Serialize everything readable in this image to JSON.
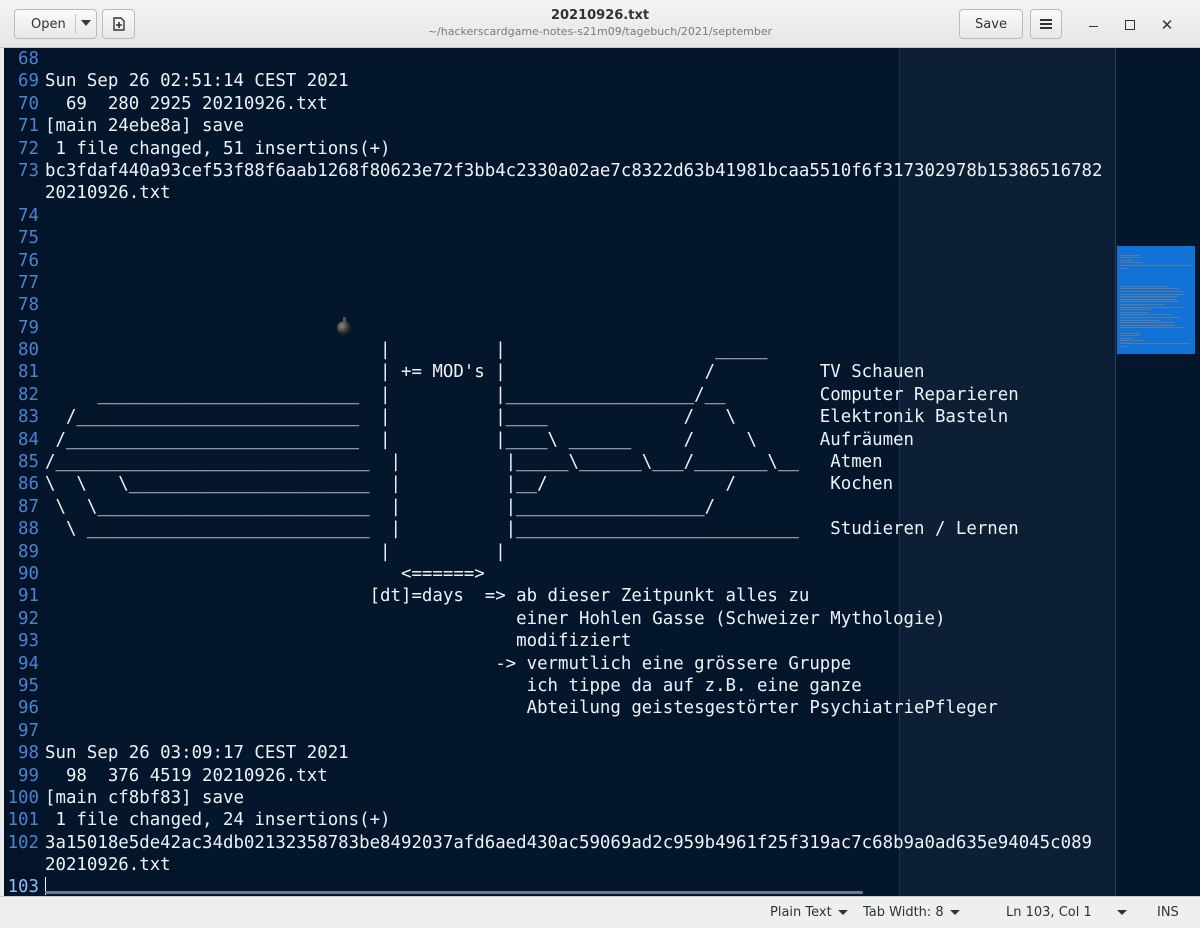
{
  "header": {
    "open_label": "Open",
    "save_label": "Save",
    "title": "20210926.txt",
    "subtitle": "~/hackerscardgame-notes-s21m09/tagebuch/2021/september"
  },
  "editor": {
    "line_numbers": [
      "68",
      "69",
      "70",
      "71",
      "72",
      "73",
      "",
      "74",
      "75",
      "76",
      "77",
      "78",
      "79",
      "80",
      "81",
      "82",
      "83",
      "84",
      "85",
      "86",
      "87",
      "88",
      "89",
      "90",
      "91",
      "92",
      "93",
      "94",
      "95",
      "96",
      "97",
      "98",
      "99",
      "100",
      "101",
      "102",
      "",
      "103"
    ],
    "lines": [
      "",
      "Sun Sep 26 02:51:14 CEST 2021",
      "  69  280 2925 20210926.txt",
      "[main 24ebe8a] save",
      " 1 file changed, 51 insertions(+)",
      "bc3fdaf440a93cef53f88f6aab1268f80623e72f3bb4c2330a02ae7c8322d63b41981bcaa5510f6f317302978b15386516782",
      "20210926.txt",
      "",
      "",
      "",
      "",
      "",
      "",
      "                                |          |                    _____",
      "                                | += MOD's |                   /          TV Schauen",
      "     _________________________  |          |__________________/__         Computer Reparieren",
      "  /___________________________  |          |____             /   \\        Elektronik Basteln",
      " /____________________________  |          |____\\ ______     /     \\      Aufräumen",
      "/______________________________  |          |_____\\______\\___/_______\\__   Atmen",
      "\\  \\   \\_______________________  |          |__/                 /         Kochen",
      " \\  \\__________________________  |          |__________________/",
      "  \\ ___________________________  |          |___________________________   Studieren / Lernen",
      "                                |          |",
      "                                  <======>",
      "                               [dt]=days  => ab dieser Zeitpunkt alles zu",
      "                                             einer Hohlen Gasse (Schweizer Mythologie)",
      "                                             modifiziert",
      "                                           -> vermutlich eine grössere Gruppe",
      "                                              ich tippe da auf z.B. eine ganze",
      "                                              Abteilung geistesgestörter PsychiatriePfleger",
      "",
      "Sun Sep 26 03:09:17 CEST 2021",
      "  98  376 4519 20210926.txt",
      "[main cf8bf83] save",
      " 1 file changed, 24 insertions(+)",
      "3a15018e5de42ac34db02132358783be8492037afd6aed430ac59069ad2c959b4961f25f319ac7c68b9a0ad635e94045c089",
      "20210926.txt",
      ""
    ]
  },
  "statusbar": {
    "language": "Plain Text",
    "tab_width": "Tab Width: 8",
    "position": "Ln 103, Col 1",
    "mode": "INS"
  },
  "colors": {
    "editor_bg": "#04162c",
    "line_number": "#4a86cf",
    "text": "#eef2f7",
    "minimap_viewport": "#1172d8"
  }
}
